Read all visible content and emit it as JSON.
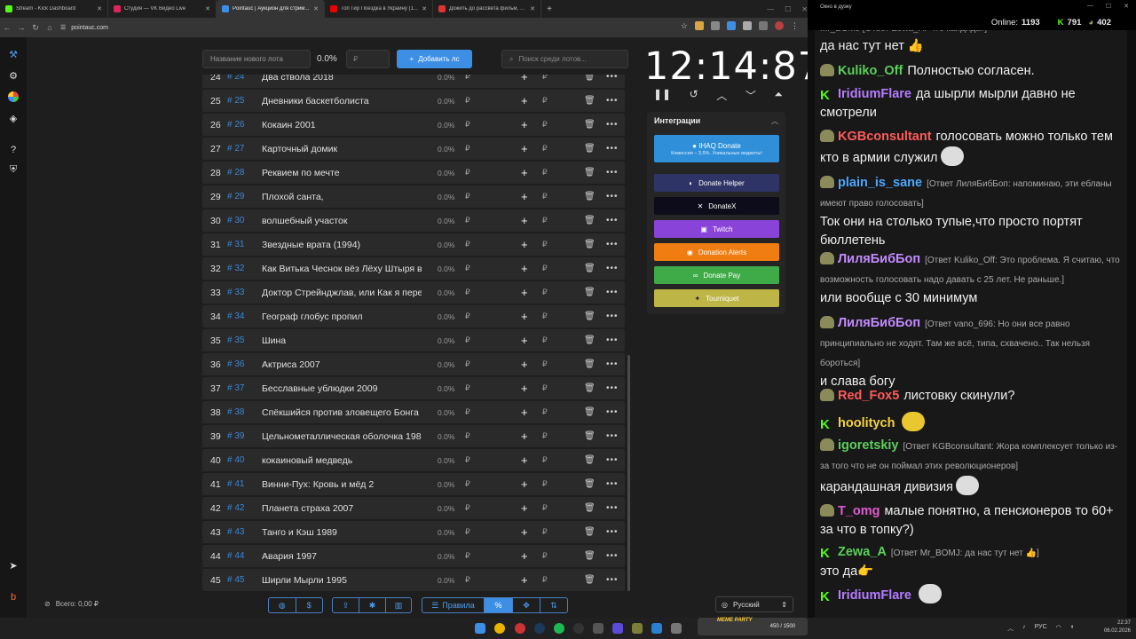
{
  "browser": {
    "tabs": [
      {
        "title": "Stream - Kick Dashboard",
        "color": "#53fc18"
      },
      {
        "title": "Студия — VK Видео Live",
        "color": "#e0245e"
      },
      {
        "title": "Pointauc | Аукцион для стрим...",
        "color": "#3d8fe6",
        "active": true
      },
      {
        "title": "Топ Гир Поездка в Украину (1...",
        "color": "#e00"
      },
      {
        "title": "Дожить до рассвета фильм, 20...",
        "color": "#d33"
      }
    ],
    "url": "pointauc.com"
  },
  "toolbar": {
    "new_lot_placeholder": "Название нового лота",
    "percent": "0.0%",
    "amount_placeholder": "₽",
    "add_label": "Добавить лс",
    "search_placeholder": "Поиск среди лотов..."
  },
  "lots": [
    {
      "n": "24",
      "h": "# 24",
      "name": "Два ствола 2018",
      "pct": "0.0%"
    },
    {
      "n": "25",
      "h": "# 25",
      "name": "Дневники баскетболиста",
      "pct": "0.0%"
    },
    {
      "n": "26",
      "h": "# 26",
      "name": "Кокаин 2001",
      "pct": "0.0%"
    },
    {
      "n": "27",
      "h": "# 27",
      "name": "Карточный домик",
      "pct": "0.0%"
    },
    {
      "n": "28",
      "h": "# 28",
      "name": "Реквием по мечте",
      "pct": "0.0%"
    },
    {
      "n": "29",
      "h": "# 29",
      "name": "Плохой санта,",
      "pct": "0.0%"
    },
    {
      "n": "30",
      "h": "# 30",
      "name": "волшебный участок",
      "pct": "0.0%"
    },
    {
      "n": "31",
      "h": "# 31",
      "name": "Звездные врата (1994)",
      "pct": "0.0%"
    },
    {
      "n": "32",
      "h": "# 32",
      "name": "Как Витька Чеснок вёз Лёху Штыря в",
      "pct": "0.0%"
    },
    {
      "n": "33",
      "h": "# 33",
      "name": "Доктор Стрейнджлав, или Как я пере",
      "pct": "0.0%"
    },
    {
      "n": "34",
      "h": "# 34",
      "name": "Географ глобус пропил",
      "pct": "0.0%"
    },
    {
      "n": "35",
      "h": "# 35",
      "name": "Шина",
      "pct": "0.0%"
    },
    {
      "n": "36",
      "h": "# 36",
      "name": "Актриса 2007",
      "pct": "0.0%"
    },
    {
      "n": "37",
      "h": "# 37",
      "name": "Бесславные ублюдки 2009",
      "pct": "0.0%"
    },
    {
      "n": "38",
      "h": "# 38",
      "name": "Спёкшийся против зловещего Бонга",
      "pct": "0.0%"
    },
    {
      "n": "39",
      "h": "# 39",
      "name": "Цельнометаллическая оболочка 198",
      "pct": "0.0%"
    },
    {
      "n": "40",
      "h": "# 40",
      "name": "кокаиновый медведь",
      "pct": "0.0%"
    },
    {
      "n": "41",
      "h": "# 41",
      "name": "Винни-Пух: Кровь и мёд 2",
      "pct": "0.0%"
    },
    {
      "n": "42",
      "h": "# 42",
      "name": "Планета страха 2007",
      "pct": "0.0%"
    },
    {
      "n": "43",
      "h": "# 43",
      "name": "Танго и Кэш 1989",
      "pct": "0.0%"
    },
    {
      "n": "44",
      "h": "# 44",
      "name": "Авария 1997",
      "pct": "0.0%"
    },
    {
      "n": "45",
      "h": "# 45",
      "name": "Ширли Мырли 1995",
      "pct": "0.0%"
    }
  ],
  "currency": "₽",
  "timer": {
    "value": "12:14:87"
  },
  "integrations": {
    "title": "Интеграции",
    "buttons": [
      {
        "label": "IHAQ Donate",
        "sub": "Комиссия – 3,5%. Уникальные виджеты!",
        "color": "#2f8fd9",
        "icon": "ihaq-donate-icon"
      },
      {
        "label": "Donate Helper",
        "color": "#2f3466",
        "icon": "donate-helper-icon"
      },
      {
        "label": "DonateX",
        "color": "#0c0c1a",
        "icon": "donatex-icon"
      },
      {
        "label": "Twitch",
        "color": "#8a43d8",
        "icon": "twitch-icon"
      },
      {
        "label": "Donation Alerts",
        "color": "#f07d12",
        "icon": "donation-alerts-icon"
      },
      {
        "label": "Donate Pay",
        "color": "#3faa48",
        "icon": "donate-pay-icon"
      },
      {
        "label": "Tourniquet",
        "color": "#bdb545",
        "icon": "tourniquet-icon"
      }
    ]
  },
  "footer": {
    "total": "Всего: 0,00 ₽",
    "rules_label": "Правила",
    "language": "Русский"
  },
  "chat": {
    "window_title": "Окно в дуэку",
    "online_label": "Online:",
    "online_count": "1193",
    "kick_count": "791",
    "vk_count": "402",
    "top_partial": "Mr_BOMJ [Ответ Zewa_A: Что кандидат]",
    "messages": [
      {
        "badge": "none",
        "user": "",
        "color": "#eee",
        "reply": "",
        "text": "да нас тут нет 👍"
      },
      {
        "badge": "cow",
        "user": "Kuliko_Off",
        "color": "#5ad05a",
        "reply": "",
        "text": "Полностью согласен."
      },
      {
        "badge": "k",
        "user": "IridiumFlare",
        "color": "#b57cff",
        "reply": "",
        "text": "да шырли мырли давно не смотрели"
      },
      {
        "badge": "cow",
        "user": "KGBconsultant",
        "color": "#ff5a5a",
        "reply": "",
        "text": "голосовать можно только тем кто в армии служил"
      },
      {
        "badge": "cow",
        "user": "plain_is_sane",
        "color": "#4aa8ff",
        "reply": "[Ответ ЛиляБибБоп: напоминаю, эти ебланы имеют право голосовать]",
        "text": "Ток они на столько тупые,что просто портят бюллетень"
      },
      {
        "badge": "cow",
        "user": "ЛиляБибБоп",
        "color": "#c48bff",
        "reply": "[Ответ Kuliko_Off: Это проблема. Я считаю, что возможность голосовать надо давать с 25 лет. Не раньше.]",
        "text": "или вообще с 30 минимум"
      },
      {
        "badge": "cow",
        "user": "ЛиляБибБоп",
        "color": "#c48bff",
        "reply": "[Ответ vano_696: Но они все равно принципиально не ходят. Там же всё, типа, схвачено.. Так нельзя бороться]",
        "text": "и слава богу"
      },
      {
        "badge": "cow",
        "user": "Red_Fox5",
        "color": "#ff5a5a",
        "reply": "",
        "text": "листовку скинули?"
      },
      {
        "badge": "k",
        "user": "hoolitych",
        "color": "#f5d33a",
        "reply": "",
        "text": ""
      },
      {
        "badge": "cow",
        "user": "igoretskiy",
        "color": "#5ad05a",
        "reply": "[Ответ KGBconsultant: Жора комплексует только из-за того что не он поймал этих революционеров]",
        "text": "карандашная дивизия"
      },
      {
        "badge": "cow",
        "user": "T_omg",
        "color": "#e05ad0",
        "reply": "",
        "text": "малые понятно, а пенсионеров то 60+ за что в топку?)"
      },
      {
        "badge": "k",
        "user": "Zewa_A",
        "color": "#5ad05a",
        "reply": "[Ответ Mr_BOMJ: да нас тут нет 👍]",
        "text": "это да👉"
      },
      {
        "badge": "k",
        "user": "IridiumFlare",
        "color": "#b57cff",
        "reply": "",
        "text": ""
      }
    ]
  },
  "taskbar": {
    "time": "22:37",
    "date": "06.02.2026",
    "lang": "РУС",
    "meme_label": "MEME PARTY",
    "meme_count": "450 / 1500"
  }
}
